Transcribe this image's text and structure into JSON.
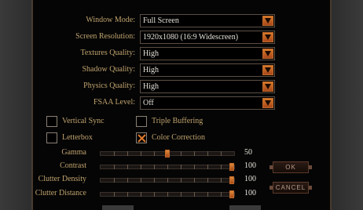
{
  "settings": {
    "window_mode": {
      "label": "Window Mode:",
      "value": "Full Screen"
    },
    "screen_resolution": {
      "label": "Screen Resolution:",
      "value": "1920x1080 (16:9 Widescreen)"
    },
    "textures_quality": {
      "label": "Textures Quality:",
      "value": "High"
    },
    "shadow_quality": {
      "label": "Shadow Quality:",
      "value": "High"
    },
    "physics_quality": {
      "label": "Physics Quality:",
      "value": "High"
    },
    "fsaa_level": {
      "label": "FSAA Level:",
      "value": "Off"
    }
  },
  "checkboxes": {
    "vertical_sync": {
      "label": "Vertical Sync",
      "checked": false
    },
    "triple_buffering": {
      "label": "Triple Buffering",
      "checked": false
    },
    "letterbox": {
      "label": "Letterbox",
      "checked": false
    },
    "color_correction": {
      "label": "Color Correction",
      "checked": true
    }
  },
  "sliders": {
    "gamma": {
      "label": "Gamma",
      "value": "50",
      "level": 0.5
    },
    "contrast": {
      "label": "Contrast",
      "value": "100",
      "level": 1.0
    },
    "clutter_density": {
      "label": "Clutter Density",
      "value": "100",
      "level": 1.0
    },
    "clutter_distance": {
      "label": "Clutter Distance",
      "value": "100",
      "level": 1.0
    }
  },
  "buttons": {
    "ok": "OK",
    "cancel": "CANCEL"
  },
  "colors": {
    "label_gold": "#c0a36e",
    "accent_orange": "#d87a2a",
    "value_text": "#e6e2da"
  }
}
